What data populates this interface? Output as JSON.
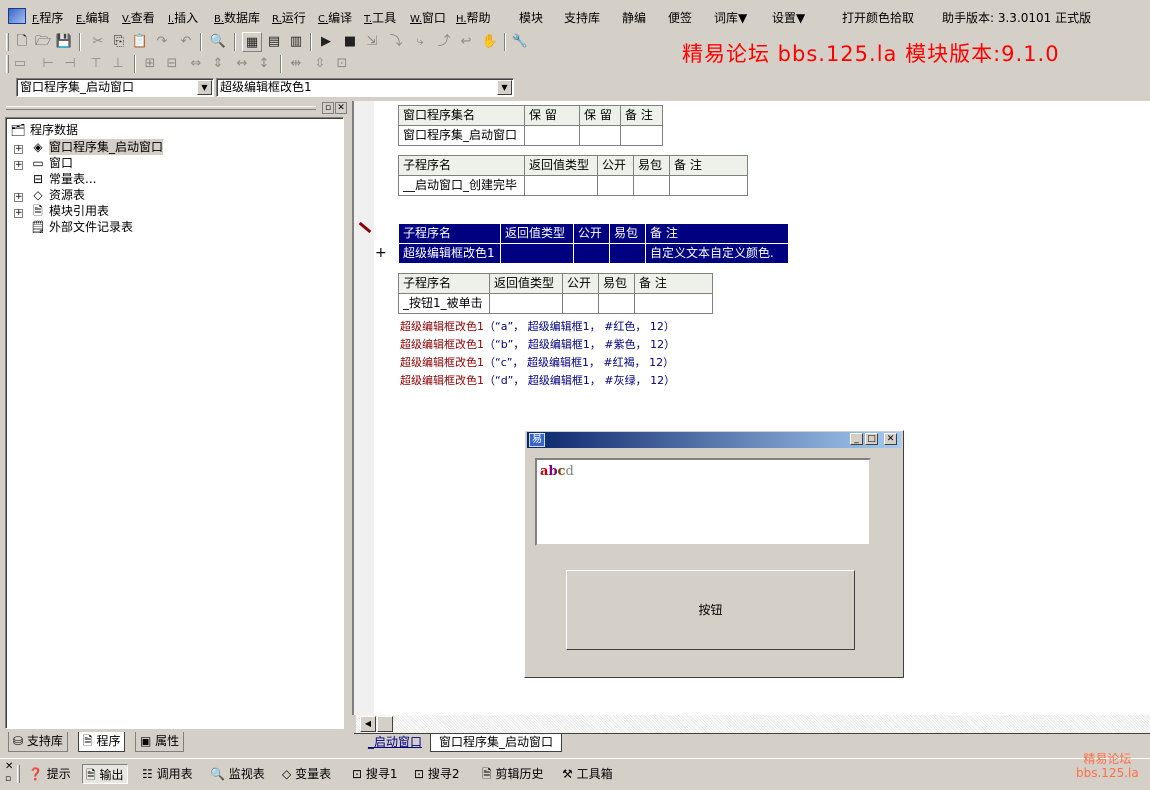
{
  "menu": [
    {
      "key": "F.",
      "label": "程序"
    },
    {
      "key": "E.",
      "label": "编辑"
    },
    {
      "key": "V.",
      "label": "查看"
    },
    {
      "key": "I.",
      "label": "插入"
    },
    {
      "key": "B.",
      "label": "数据库"
    },
    {
      "key": "R.",
      "label": "运行"
    },
    {
      "key": "C.",
      "label": "编译"
    },
    {
      "key": "T.",
      "label": "工具"
    },
    {
      "key": "W.",
      "label": "窗口"
    },
    {
      "key": "H.",
      "label": "帮助"
    }
  ],
  "extra_menu": [
    "模块",
    "支持库",
    "静编",
    "便签",
    "词库▼",
    "设置▼",
    "打开颜色拾取"
  ],
  "assistant_version": "助手版本: 3.3.0101 正式版",
  "forum_title": "精易论坛 bbs.125.la 模块版本:9.1.0",
  "combo": {
    "window_set": "窗口程序集_启动窗口",
    "subprogram": "超级编辑框改色1"
  },
  "tree": {
    "root": "程序数据",
    "items": [
      "窗口程序集_启动窗口",
      "窗口",
      "常量表...",
      "资源表",
      "模块引用表",
      "外部文件记录表"
    ]
  },
  "left_tabs": [
    "支持库",
    "程序",
    "属性"
  ],
  "table1": {
    "headers": [
      "窗口程序集名",
      "保 留",
      "保 留",
      "备 注"
    ],
    "row": [
      "窗口程序集_启动窗口",
      "",
      "",
      ""
    ]
  },
  "table2": {
    "headers": [
      "子程序名",
      "返回值类型",
      "公开",
      "易包",
      "备 注"
    ],
    "row": [
      "__启动窗口_创建完毕",
      "",
      "",
      "",
      ""
    ]
  },
  "table3": {
    "headers": [
      "子程序名",
      "返回值类型",
      "公开",
      "易包",
      "备 注"
    ],
    "row": [
      "超级编辑框改色1",
      "",
      "",
      "",
      "自定义文本自定义颜色."
    ]
  },
  "table4": {
    "headers": [
      "子程序名",
      "返回值类型",
      "公开",
      "易包",
      "备 注"
    ],
    "row": [
      "_按钮1_被单击",
      "",
      "",
      "",
      ""
    ]
  },
  "code_lines": [
    {
      "func": "超级编辑框改色1",
      "args": "（“a”， 超级编辑框1， #红色， 12）"
    },
    {
      "func": "超级编辑框改色1",
      "args": "（“b”， 超级编辑框1， #紫色， 12）"
    },
    {
      "func": "超级编辑框改色1",
      "args": "（“c”， 超级编辑框1， #红褐， 12）"
    },
    {
      "func": "超级编辑框改色1",
      "args": "（“d”， 超级编辑框1， #灰绿， 12）"
    }
  ],
  "child_window": {
    "edit_chars": [
      {
        "ch": "a",
        "color": "#cc0000"
      },
      {
        "ch": "b",
        "color": "#800080"
      },
      {
        "ch": "c",
        "color": "#804000"
      },
      {
        "ch": "d",
        "color": "#808080"
      }
    ],
    "button_label": "按钮"
  },
  "doc_tabs": [
    "_启动窗口",
    "窗口程序集_启动窗口"
  ],
  "bottom_tabs": [
    "提示",
    "输出",
    "调用表",
    "监视表",
    "变量表",
    "搜寻1",
    "搜寻2",
    "剪辑历史",
    "工具箱"
  ],
  "watermark": {
    "line1": "精易论坛",
    "line2": "bbs.125.la"
  },
  "colors": {
    "accent_red": "#ff0000",
    "selection": "#000080"
  }
}
